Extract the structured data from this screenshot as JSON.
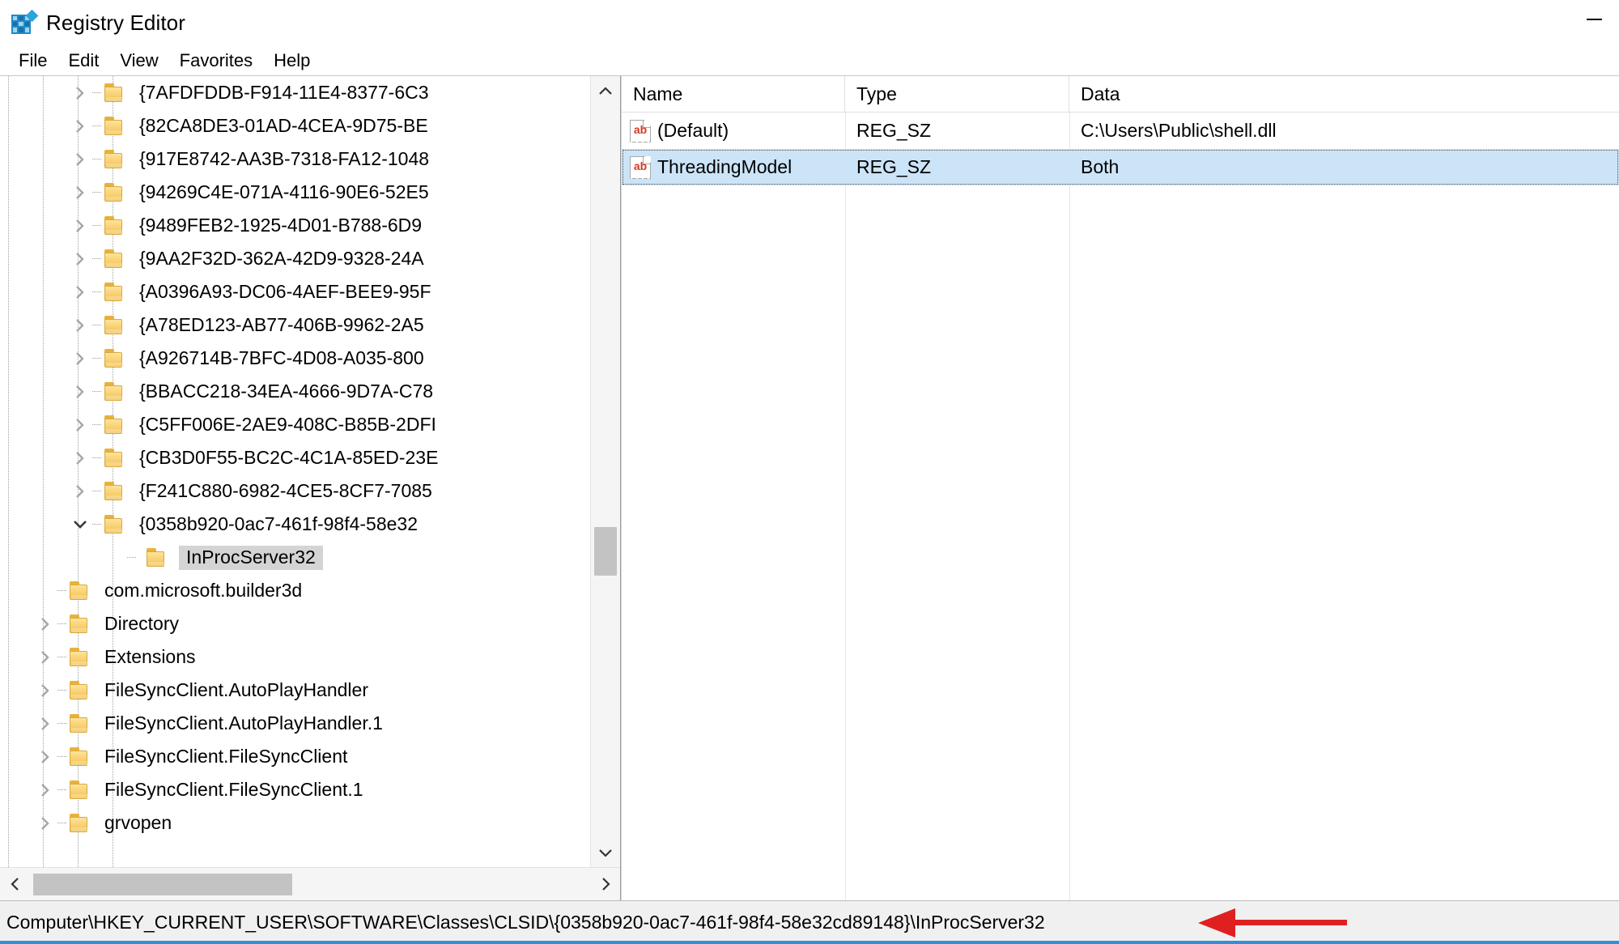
{
  "window": {
    "title": "Registry Editor",
    "icon": "registry-icon",
    "minimize_label": "—"
  },
  "menubar": {
    "items": [
      {
        "label": "File"
      },
      {
        "label": "Edit"
      },
      {
        "label": "View"
      },
      {
        "label": "Favorites"
      },
      {
        "label": "Help"
      }
    ]
  },
  "tree": {
    "items": [
      {
        "label": "{7AFDFDDB-F914-11E4-8377-6C3",
        "expander": "collapsed",
        "indent": 3,
        "selected": false
      },
      {
        "label": "{82CA8DE3-01AD-4CEA-9D75-BE",
        "expander": "collapsed",
        "indent": 3,
        "selected": false
      },
      {
        "label": "{917E8742-AA3B-7318-FA12-1048",
        "expander": "collapsed",
        "indent": 3,
        "selected": false
      },
      {
        "label": "{94269C4E-071A-4116-90E6-52E5",
        "expander": "collapsed",
        "indent": 3,
        "selected": false
      },
      {
        "label": "{9489FEB2-1925-4D01-B788-6D9",
        "expander": "collapsed",
        "indent": 3,
        "selected": false
      },
      {
        "label": "{9AA2F32D-362A-42D9-9328-24A",
        "expander": "collapsed",
        "indent": 3,
        "selected": false
      },
      {
        "label": "{A0396A93-DC06-4AEF-BEE9-95F",
        "expander": "collapsed",
        "indent": 3,
        "selected": false
      },
      {
        "label": "{A78ED123-AB77-406B-9962-2A5",
        "expander": "collapsed",
        "indent": 3,
        "selected": false
      },
      {
        "label": "{A926714B-7BFC-4D08-A035-800",
        "expander": "collapsed",
        "indent": 3,
        "selected": false
      },
      {
        "label": "{BBACC218-34EA-4666-9D7A-C78",
        "expander": "collapsed",
        "indent": 3,
        "selected": false
      },
      {
        "label": "{C5FF006E-2AE9-408C-B85B-2DFI",
        "expander": "collapsed",
        "indent": 3,
        "selected": false
      },
      {
        "label": "{CB3D0F55-BC2C-4C1A-85ED-23E",
        "expander": "collapsed",
        "indent": 3,
        "selected": false
      },
      {
        "label": "{F241C880-6982-4CE5-8CF7-7085",
        "expander": "collapsed",
        "indent": 3,
        "selected": false
      },
      {
        "label": "{0358b920-0ac7-461f-98f4-58e32",
        "expander": "expanded",
        "indent": 3,
        "selected": false
      },
      {
        "label": "InProcServer32",
        "expander": "none",
        "indent": 4,
        "selected": true
      },
      {
        "label": "com.microsoft.builder3d",
        "expander": "none",
        "indent": 2,
        "selected": false
      },
      {
        "label": "Directory",
        "expander": "collapsed",
        "indent": 2,
        "selected": false
      },
      {
        "label": "Extensions",
        "expander": "collapsed",
        "indent": 2,
        "selected": false
      },
      {
        "label": "FileSyncClient.AutoPlayHandler",
        "expander": "collapsed",
        "indent": 2,
        "selected": false
      },
      {
        "label": "FileSyncClient.AutoPlayHandler.1",
        "expander": "collapsed",
        "indent": 2,
        "selected": false
      },
      {
        "label": "FileSyncClient.FileSyncClient",
        "expander": "collapsed",
        "indent": 2,
        "selected": false
      },
      {
        "label": "FileSyncClient.FileSyncClient.1",
        "expander": "collapsed",
        "indent": 2,
        "selected": false
      },
      {
        "label": "grvopen",
        "expander": "collapsed",
        "indent": 2,
        "selected": false
      }
    ],
    "scrollbar": {
      "up_arrow": "chevron-up",
      "down_arrow": "chevron-down",
      "left_arrow": "chevron-left",
      "right_arrow": "chevron-right"
    }
  },
  "values_list": {
    "columns": [
      {
        "label": "Name"
      },
      {
        "label": "Type"
      },
      {
        "label": "Data"
      }
    ],
    "rows": [
      {
        "name": "(Default)",
        "type": "REG_SZ",
        "data": "C:\\Users\\Public\\shell.dll",
        "icon": "string-value-icon",
        "selected": false
      },
      {
        "name": "ThreadingModel",
        "type": "REG_SZ",
        "data": "Both",
        "icon": "string-value-icon",
        "selected": true
      }
    ]
  },
  "statusbar": {
    "path": "Computer\\HKEY_CURRENT_USER\\SOFTWARE\\Classes\\CLSID\\{0358b920-0ac7-461f-98f4-58e32cd89148}\\InProcServer32",
    "annotation": "red-arrow-pointing-left"
  },
  "colors": {
    "selection_blue": "#cce4f7",
    "selection_gray": "#d4d4d4",
    "folder_yellow": "#f8d071",
    "annotation_red": "#e02020",
    "accent_blue": "#2f8fd8",
    "title_icon_blue": "#1f8ac9"
  }
}
